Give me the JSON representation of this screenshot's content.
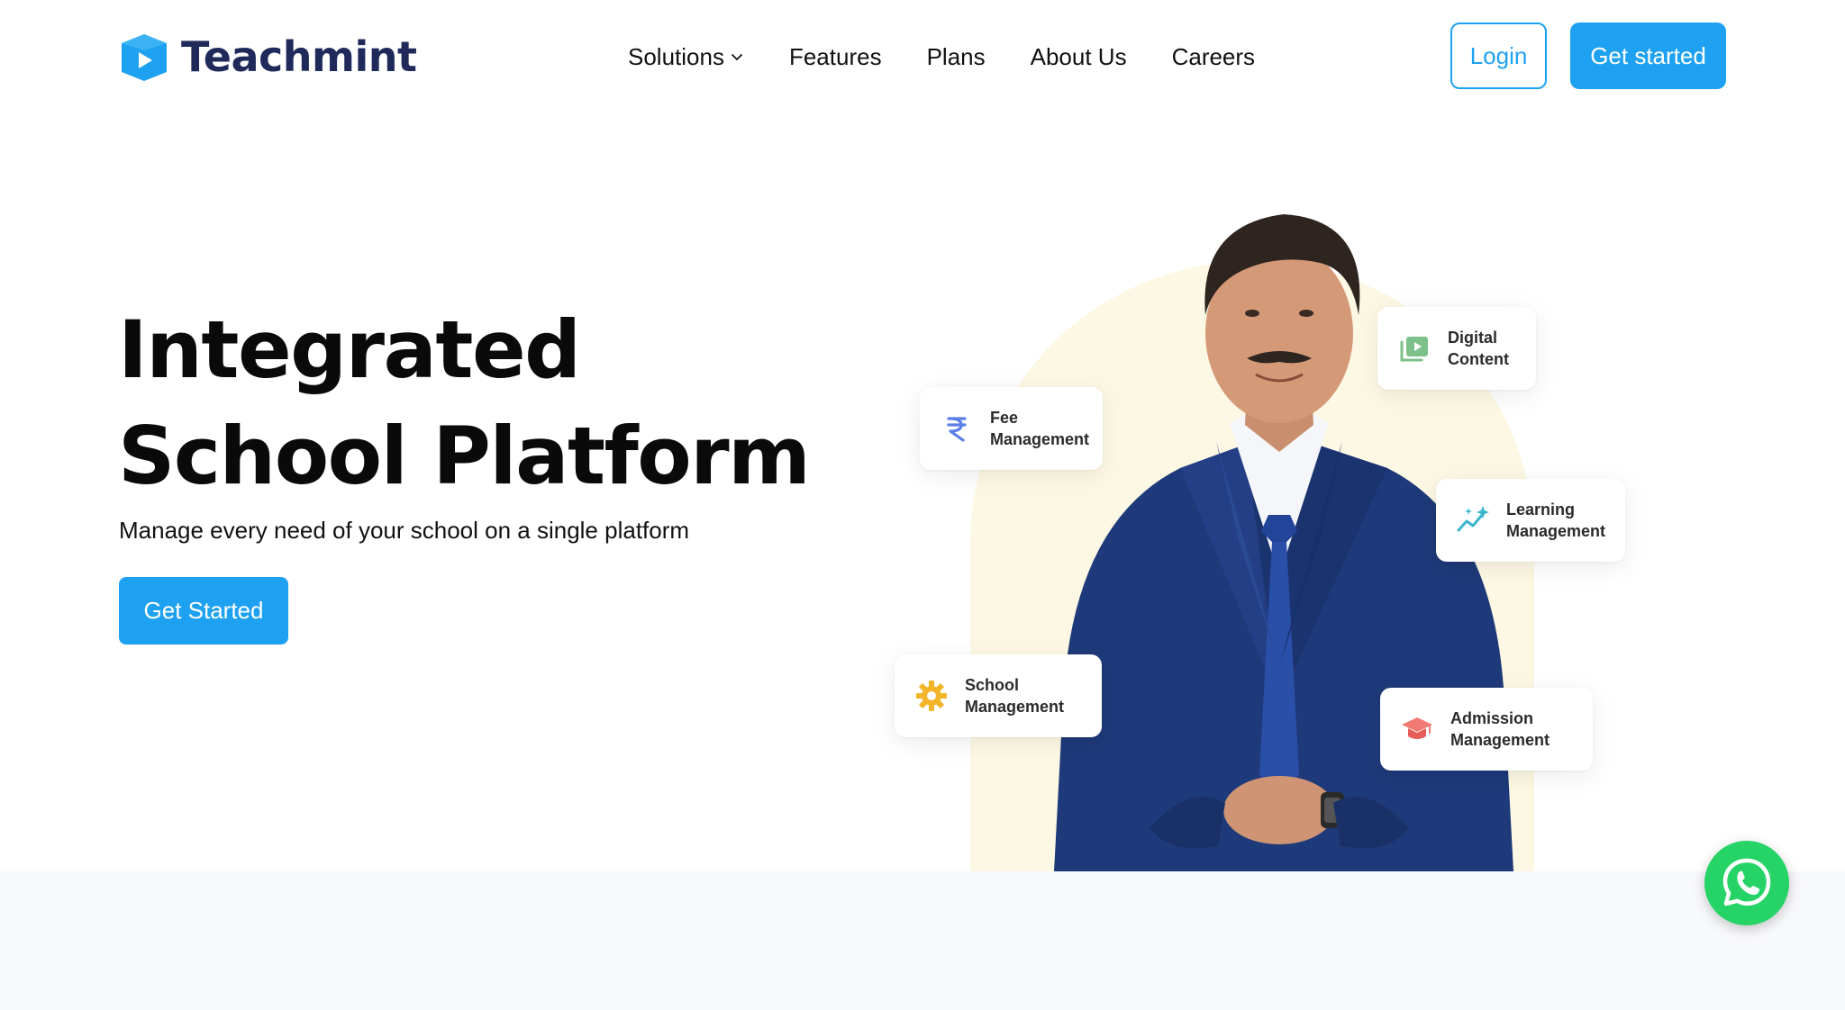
{
  "header": {
    "logo_text": "Teachmint",
    "nav": [
      {
        "label": "Solutions",
        "has_dropdown": true
      },
      {
        "label": "Features"
      },
      {
        "label": "Plans"
      },
      {
        "label": "About Us"
      },
      {
        "label": "Careers"
      }
    ],
    "login_label": "Login",
    "cta_label": "Get started"
  },
  "hero": {
    "title_line1": "Integrated",
    "title_line2": "School Platform",
    "subtitle": "Manage every need of your school on a single platform",
    "cta_label": "Get Started"
  },
  "feature_cards": [
    {
      "line1": "Fee",
      "line2": "Management",
      "icon": "rupee-icon"
    },
    {
      "line1": "Digital",
      "line2": "Content",
      "icon": "video-library-icon"
    },
    {
      "line1": "Learning",
      "line2": "Management",
      "icon": "sparkle-chart-icon"
    },
    {
      "line1": "School",
      "line2": "Management",
      "icon": "gear-icon"
    },
    {
      "line1": "Admission",
      "line2": "Management",
      "icon": "graduation-cap-icon"
    }
  ],
  "colors": {
    "primary": "#1ea1f1",
    "logo_text": "#1f2a5a",
    "arch": "#fdf8e4",
    "whatsapp": "#25d366",
    "bottom_strip": "#f8f9fb"
  },
  "whatsapp_icon": "whatsapp-icon"
}
